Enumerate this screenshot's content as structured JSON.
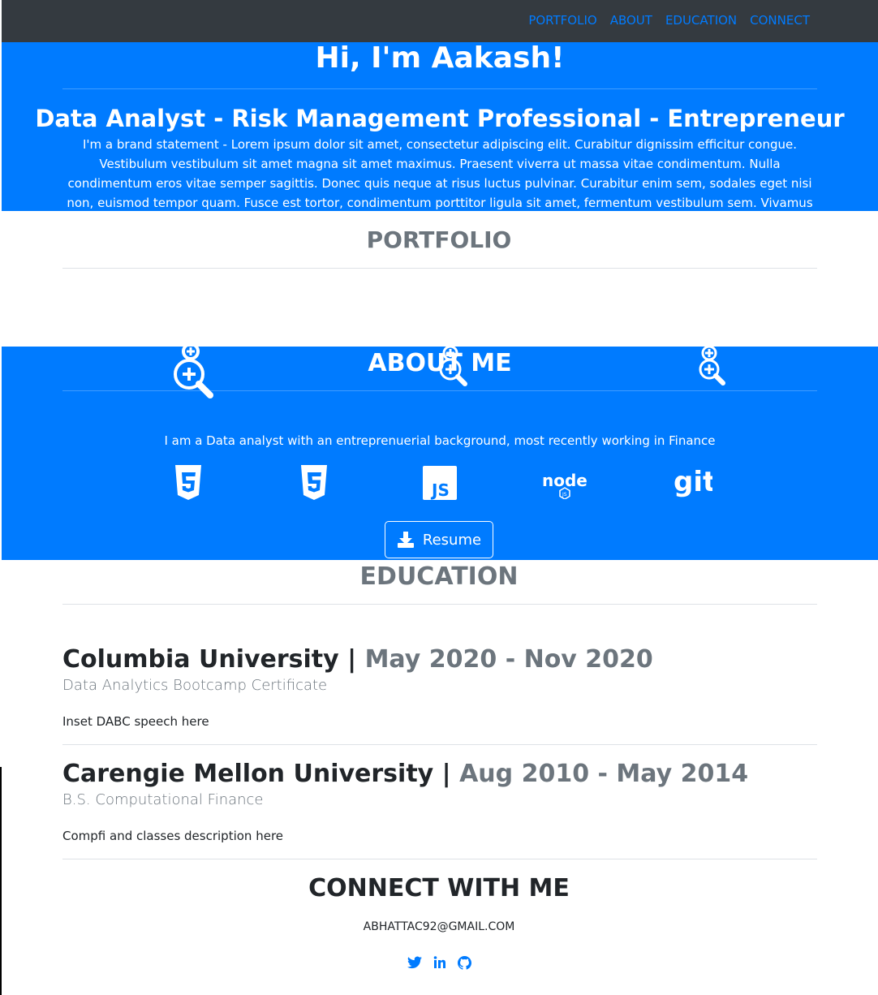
{
  "nav": {
    "items": [
      "PORTFOLIO",
      "ABOUT",
      "EDUCATION",
      "CONNECT"
    ]
  },
  "hero": {
    "greeting": "Hi, I'm Aakash!",
    "tagline": "Data Analyst - Risk Management Professional - Entrepreneur",
    "statement": "I'm a brand statement - Lorem ipsum dolor sit amet, consectetur adipiscing elit. Curabitur dignissim efficitur congue. Vestibulum vestibulum sit amet magna sit amet maximus. Praesent viverra ut massa vitae condimentum. Nulla condimentum eros vitae semper sagittis. Donec quis neque at risus luctus pulvinar. Curabitur enim sem, sodales eget nisi non, euismod tempor quam. Fusce est tortor, condimentum porttitor ligula sit amet, fermentum vestibulum sem. Vivamus venenatis felis ac fringilla viverra."
  },
  "portfolio": {
    "title": "PORTFOLIO"
  },
  "about": {
    "title": "ABOUT ME",
    "description": "I am a Data analyst with an entreprenuerial background, most recently working in Finance",
    "skills": [
      "html5-icon",
      "css3-icon",
      "js-icon",
      "node-icon",
      "git-icon"
    ],
    "resume_label": "Resume"
  },
  "education": {
    "title": "EDUCATION",
    "items": [
      {
        "school": "Columbia University",
        "separator": " | ",
        "dates": "May 2020 - Nov 2020",
        "degree": "Data Analytics Bootcamp Certificate",
        "note": "Inset DABC speech here"
      },
      {
        "school": "Carengie Mellon University",
        "separator": " | ",
        "dates": "Aug 2010 - May 2014",
        "degree": "B.S. Computational Finance",
        "note": "Compfi and classes description here"
      }
    ]
  },
  "connect": {
    "title": "CONNECT WITH ME",
    "email": "ABHATTAC92@GMAIL.COM",
    "socials": [
      "twitter-icon",
      "linkedin-icon",
      "github-icon"
    ]
  },
  "colors": {
    "primary": "#007bff",
    "navbar": "#343a40",
    "muted": "#6c757d"
  }
}
